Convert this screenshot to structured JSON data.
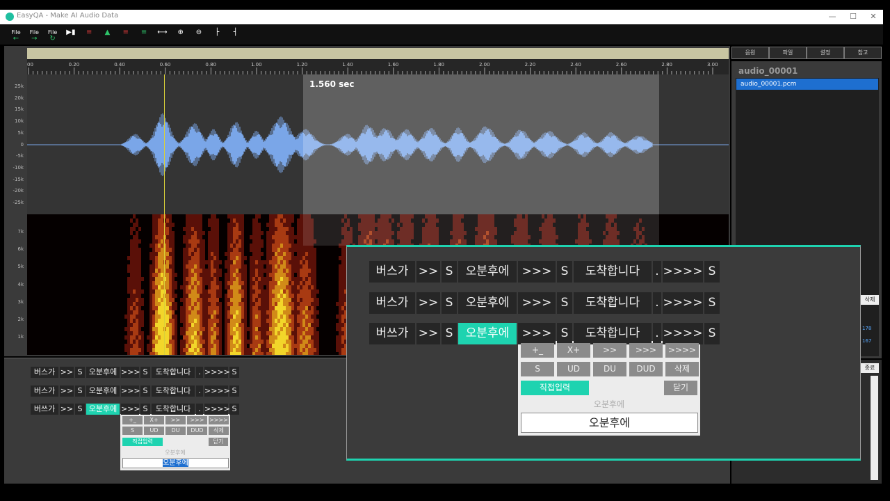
{
  "window": {
    "title": "EasyQA - Make AI Audio Data",
    "minimize": "—",
    "maximize": "☐",
    "close": "✕"
  },
  "toolbar": {
    "buttons": [
      {
        "name": "file-prev",
        "label": "File",
        "icon": "←",
        "color": "#2ec76b"
      },
      {
        "name": "file-next",
        "label": "File",
        "icon": "→",
        "color": "#2ec76b"
      },
      {
        "name": "file-reload",
        "label": "File",
        "icon": "↻",
        "color": "#2ec76b"
      },
      {
        "name": "play",
        "label": "",
        "icon": "▶▮",
        "color": "#ffffff"
      },
      {
        "name": "tool-5",
        "label": "",
        "icon": "≡",
        "color": "#e03b3b"
      },
      {
        "name": "tool-6",
        "label": "",
        "icon": "▲",
        "color": "#2ec76b"
      },
      {
        "name": "tool-7",
        "label": "",
        "icon": "≡",
        "color": "#e03b3b"
      },
      {
        "name": "tool-8",
        "label": "",
        "icon": "≡",
        "color": "#2ec76b"
      },
      {
        "name": "fit",
        "label": "",
        "icon": "⟷",
        "color": "#ffffff"
      },
      {
        "name": "zoom-in",
        "label": "",
        "icon": "⊕",
        "color": "#ffffff"
      },
      {
        "name": "zoom-out",
        "label": "",
        "icon": "⊖",
        "color": "#ffffff"
      },
      {
        "name": "mark-start",
        "label": "",
        "icon": "├",
        "color": "#ffffff"
      },
      {
        "name": "mark-end",
        "label": "",
        "icon": "┤",
        "color": "#ffffff"
      }
    ]
  },
  "timeline": {
    "ticks": [
      "00",
      "0.20",
      "0.40",
      "0.60",
      "0.80",
      "1.00",
      "1.20",
      "1.40",
      "1.60",
      "1.80",
      "2.00",
      "2.20",
      "2.40",
      "2.60",
      "2.80",
      "3.00"
    ],
    "selection_label": "1.560 sec"
  },
  "waveform": {
    "ylabels": [
      "25k",
      "20k",
      "15k",
      "10k",
      "5k",
      "0",
      "-5k",
      "-10k",
      "-15k",
      "-20k",
      "-25k"
    ]
  },
  "spectrogram": {
    "ylabels": [
      "7k",
      "6k",
      "5k",
      "4k",
      "3k",
      "2k",
      "1k"
    ]
  },
  "right_panel": {
    "tabs": [
      "음원",
      "파일",
      "설정",
      "참고"
    ],
    "title": "audio_00001",
    "files": [
      "audio_00001.pcm"
    ],
    "delete_label": "삭제",
    "close_label": "종료",
    "numbers": [
      "178",
      "167"
    ]
  },
  "transcript": {
    "rows": [
      [
        "버스가",
        ">>",
        "S",
        "오분후에",
        ">>>",
        "S",
        "도착합니다",
        ".",
        ">>>>",
        "S"
      ],
      [
        "버스가",
        ">>",
        "S",
        "오분후에",
        ">>>",
        "S",
        "도착합니다",
        ".",
        ">>>>",
        "S"
      ],
      [
        "버쓰가",
        ">>",
        "S",
        "오분후에",
        ">>>",
        "S",
        "도착합니다",
        ".",
        ">>>>",
        "S"
      ]
    ],
    "selected_row": 2,
    "selected_index": 3
  },
  "popup": {
    "row1": [
      "+_",
      "X+",
      ">>",
      ">>>",
      ">>>>"
    ],
    "row2": [
      "S",
      "UD",
      "DU",
      "DUD",
      "삭제"
    ],
    "direct_input": "직접입력",
    "close": "닫기",
    "original": "오분후에",
    "input_value": "오분후에"
  },
  "colors": {
    "accent": "#1ed3b0",
    "wave": "#7aa6e8",
    "cursor": "#d9cf3a"
  }
}
